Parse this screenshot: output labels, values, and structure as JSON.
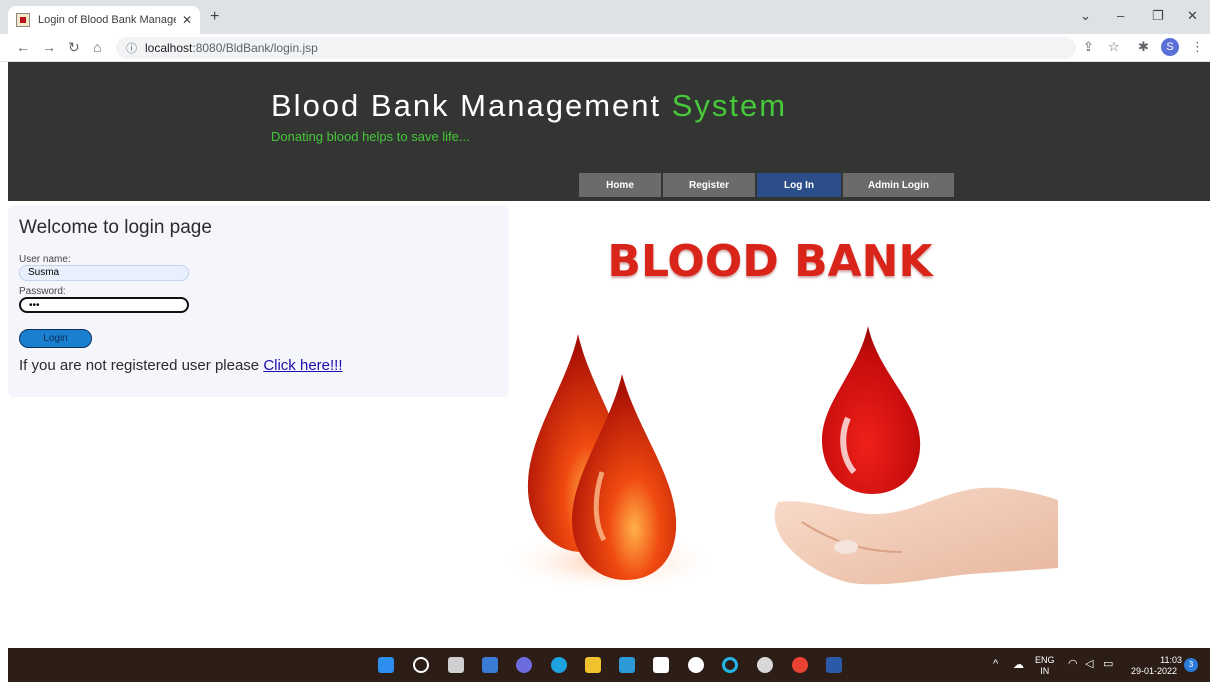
{
  "browser": {
    "tab_title": "Login of Blood Bank Manageme",
    "tab_close": "✕",
    "new_tab": "+",
    "url_host": "localhost",
    "url_rest": ":8080/BldBank/login.jsp",
    "profile_initial": "S"
  },
  "header": {
    "title_main": "Blood Bank Management",
    "title_accent": "System",
    "tagline": "Donating blood helps to save life...",
    "menu": [
      {
        "label": "Home"
      },
      {
        "label": "Register"
      },
      {
        "label": "Log In"
      },
      {
        "label": "Admin Login"
      }
    ]
  },
  "login": {
    "heading": "Welcome to login page",
    "username_label": "User name:",
    "username_value": "Susma",
    "password_label": "Password:",
    "password_value": "•••",
    "button_label": "Login",
    "register_text": "If you are not registered user please",
    "register_link": "Click here!!!"
  },
  "hero": {
    "text": "BLOOD BANK"
  },
  "taskbar": {
    "lang_line1": "ENG",
    "lang_line2": "IN",
    "time": "11:03",
    "date": "29-01-2022",
    "notification_count": "3"
  },
  "colors": {
    "header_bg": "#333533",
    "accent_green": "#46c83a",
    "menu_active": "#2b4d8a",
    "blood_red": "#d9241a"
  }
}
